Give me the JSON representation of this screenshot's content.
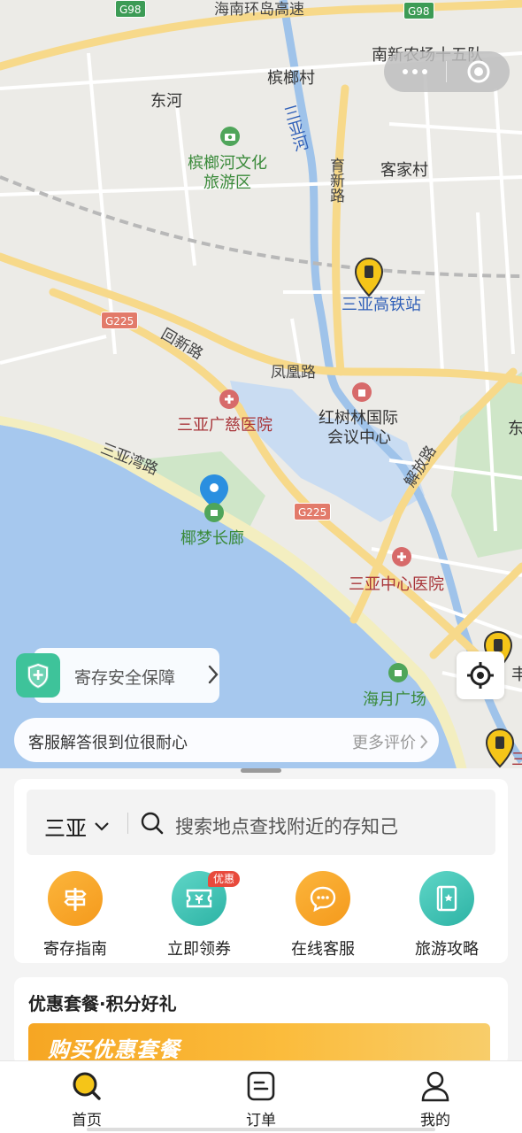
{
  "map": {
    "labels": {
      "highway_top": "海南环岛高速",
      "nanxin": "南新农场十五队",
      "binlang_village": "槟榔村",
      "donghe": "东河",
      "sanya_river": "三亚河",
      "binlang_park": "槟榔河文化",
      "binlang_park_2": "旅游区",
      "yuxin_road": "育新路",
      "kejia": "客家村",
      "station": "三亚高铁站",
      "huixin_road": "回新路",
      "fenghuang_road": "凤凰路",
      "guangci": "三亚广慈医院",
      "hongshulin": "红树林国际",
      "hongshulin_2": "会议中心",
      "sanya_bay_road": "三亚湾路",
      "jiefang": "解放路",
      "yemeng": "椰梦长廊",
      "center_hospital": "三亚中心医院",
      "haiyue": "海月广场",
      "edge_1": "东",
      "edge_2": "丰",
      "edge_3": "三"
    },
    "shields": {
      "g98_left": "G98",
      "g98_right": "G98",
      "g225_a": "G225",
      "g225_b": "G225"
    }
  },
  "safety": {
    "label": "寄存安全保障"
  },
  "review": {
    "text": "客服解答很到位很耐心",
    "more": "更多评价"
  },
  "search": {
    "city": "三亚",
    "placeholder": "搜索地点查找附近的存知己"
  },
  "services": [
    {
      "label": "寄存指南",
      "color": "#f5a623"
    },
    {
      "label": "立即领券",
      "color": "#34c3b5",
      "badge": "优惠"
    },
    {
      "label": "在线客服",
      "color": "#f5a623"
    },
    {
      "label": "旅游攻略",
      "color": "#34c3b5"
    }
  ],
  "promo": {
    "title": "优惠套餐·积分好礼",
    "banner": "购买优惠套餐"
  },
  "tabs": [
    {
      "label": "首页"
    },
    {
      "label": "订单"
    },
    {
      "label": "我的"
    }
  ],
  "colors": {
    "accent": "#f5c518",
    "teal": "#34c3b5",
    "orange": "#f5a623",
    "sea": "#a6c8ee"
  }
}
